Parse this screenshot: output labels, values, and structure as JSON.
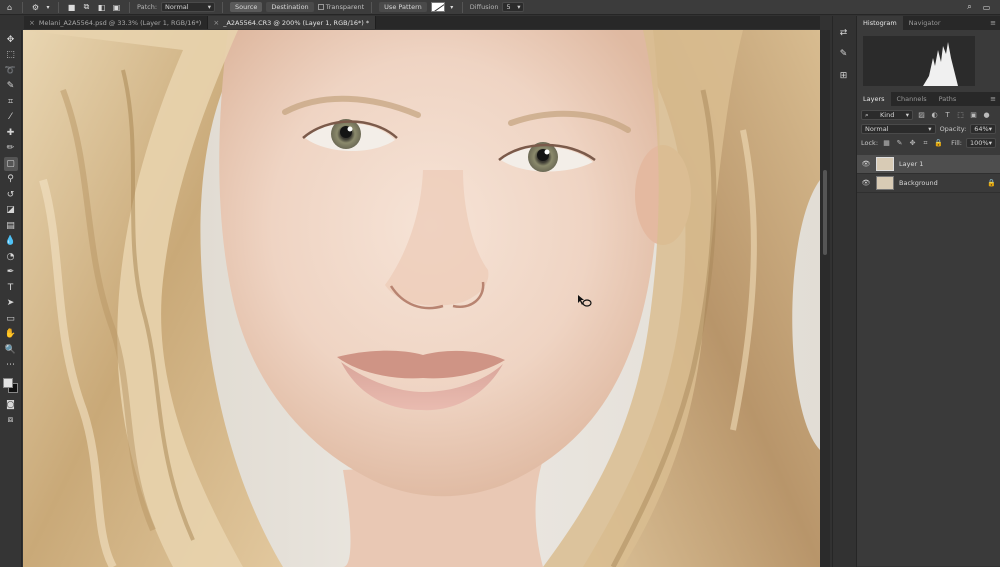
{
  "options_bar": {
    "patch_label": "Patch:",
    "patch_value": "Normal",
    "source_label": "Source",
    "destination_label": "Destination",
    "transparent_label": "Transparent",
    "use_pattern_label": "Use Pattern",
    "diffusion_label": "Diffusion",
    "diffusion_value": "5"
  },
  "tabs": [
    {
      "title": "Melani_A2A5564.psd @ 33.3% (Layer 1, RGB/16*)",
      "close": "×"
    },
    {
      "title": "_A2A5564.CR3 @ 200% (Layer 1, RGB/16*) *",
      "close": "×"
    }
  ],
  "panels": {
    "histogram_tab": "Histogram",
    "navigator_tab": "Navigator",
    "layers_tab": "Layers",
    "channels_tab": "Channels",
    "paths_tab": "Paths",
    "filter_kind": "Kind",
    "blend_mode": "Normal",
    "opacity_label": "Opacity:",
    "opacity_value": "64%",
    "lock_label": "Lock:",
    "fill_label": "Fill:",
    "fill_value": "100%",
    "layers": [
      {
        "name": "Layer 1",
        "selected": true,
        "locked": false
      },
      {
        "name": "Background",
        "selected": false,
        "locked": true
      }
    ]
  },
  "icons": {
    "toolbar": [
      "move-icon",
      "marquee-icon",
      "lasso-icon",
      "quick-select-icon",
      "crop-icon",
      "eyedropper-icon",
      "spot-heal-icon",
      "brush-icon",
      "patch-icon",
      "clone-stamp-icon",
      "history-brush-icon",
      "eraser-icon",
      "gradient-icon",
      "blur-icon",
      "dodge-icon",
      "pen-icon",
      "type-icon",
      "path-select-icon",
      "rectangle-icon",
      "hand-icon",
      "zoom-icon",
      "more-tools-icon"
    ]
  },
  "colors": {
    "foreground": "#e4e4e4",
    "background": "#111111",
    "ui_dark": "#323232"
  }
}
